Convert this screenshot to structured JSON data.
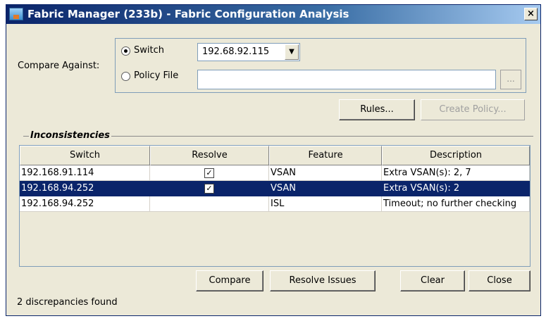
{
  "window": {
    "title": "Fabric Manager (233b) - Fabric Configuration Analysis",
    "close_glyph": "×"
  },
  "compare": {
    "label": "Compare Against:",
    "switch_option": "Switch",
    "policy_option": "Policy File",
    "selected_option": "Switch",
    "switch_value": "192.68.92.115",
    "policy_value": "",
    "browse_label": "..."
  },
  "buttons": {
    "rules": "Rules...",
    "create_policy": "Create Policy...",
    "compare": "Compare",
    "resolve_issues": "Resolve Issues",
    "clear": "Clear",
    "close": "Close"
  },
  "inconsistencies": {
    "title": "Inconsistencies",
    "columns": [
      "Switch",
      "Resolve",
      "Feature",
      "Description"
    ],
    "rows": [
      {
        "switch": "192.168.91.114",
        "resolve": true,
        "feature": "VSAN",
        "description": "Extra VSAN(s): 2, 7",
        "selected": false
      },
      {
        "switch": "192.168.94.252",
        "resolve": true,
        "feature": "VSAN",
        "description": "Extra VSAN(s): 2",
        "selected": true
      },
      {
        "switch": "192.168.94.252",
        "resolve": false,
        "feature": "ISL",
        "description": "Timeout; no further checking",
        "selected": false
      }
    ]
  },
  "status": "2 discrepancies found",
  "colors": {
    "selection": "#0a246a",
    "dialog_bg": "#ece9d8"
  },
  "icons": {
    "app": "fabric-manager-icon",
    "close": "close-icon",
    "dropdown": "chevron-down-icon",
    "check": "checkmark-icon"
  }
}
